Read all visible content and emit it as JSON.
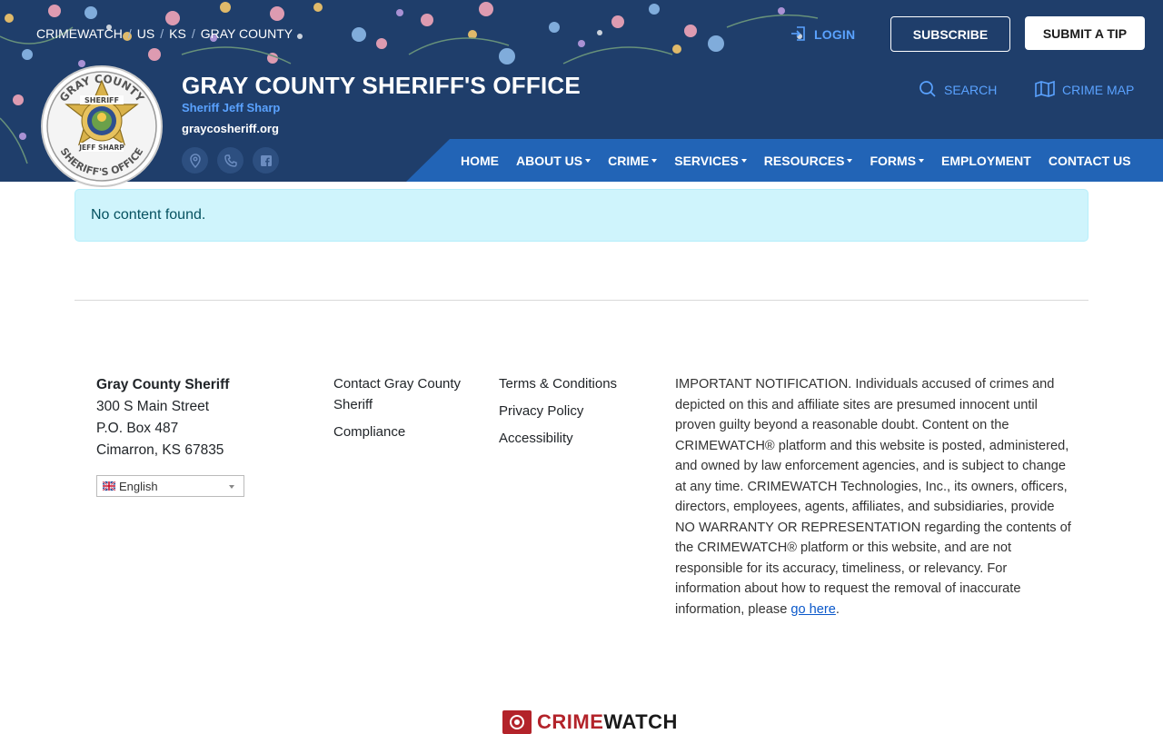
{
  "breadcrumb": [
    "CRIMEWATCH",
    "US",
    "KS",
    "GRAY COUNTY"
  ],
  "top_actions": {
    "login": "LOGIN",
    "subscribe": "SUBSCRIBE",
    "submit_tip": "SUBMIT A TIP"
  },
  "org": {
    "title": "GRAY COUNTY SHERIFF'S OFFICE",
    "subtitle": "Sheriff Jeff Sharp",
    "website": "graycosheriff.org",
    "badge_top": "GRAY COUNTY",
    "badge_star": "SHERIFF",
    "badge_name": "JEFF SHARP",
    "badge_bottom": "SHERIFF'S OFFICE"
  },
  "utility": {
    "search": "SEARCH",
    "crime_map": "CRIME MAP"
  },
  "nav": [
    {
      "label": "HOME",
      "dropdown": false
    },
    {
      "label": "ABOUT US",
      "dropdown": true
    },
    {
      "label": "CRIME",
      "dropdown": true
    },
    {
      "label": "SERVICES",
      "dropdown": true
    },
    {
      "label": "RESOURCES",
      "dropdown": true
    },
    {
      "label": "FORMS",
      "dropdown": true
    },
    {
      "label": "EMPLOYMENT",
      "dropdown": false
    },
    {
      "label": "CONTACT US",
      "dropdown": false
    }
  ],
  "alert": {
    "message": "No content found."
  },
  "footer": {
    "name": "Gray County Sheriff",
    "address1": "300 S Main Street",
    "address2": "P.O. Box 487",
    "address3": "Cimarron, KS 67835",
    "language": "English",
    "links_a": [
      "Contact Gray County Sheriff",
      "Compliance"
    ],
    "links_b": [
      "Terms & Conditions",
      "Privacy Policy",
      "Accessibility"
    ],
    "notice": "IMPORTANT NOTIFICATION. Individuals accused of crimes and depicted on this and affiliate sites are presumed innocent until proven guilty beyond a reasonable doubt. Content on the CRIMEWATCH® platform and this website is posted, administered, and owned by law enforcement agencies, and is subject to change at any time. CRIMEWATCH Technologies, Inc., its owners, officers, directors, employees, agents, affiliates, and subsidiaries, provide NO WARRANTY OR REPRESENTATION regarding the contents of the CRIMEWATCH® platform or this website, and are not responsible for its accuracy, timeliness, or relevancy. For information about how to request the removal of inaccurate information, please",
    "notice_link": "go here",
    "notice_end": ".",
    "brand_a": "CRIME",
    "brand_b": "WATCH"
  },
  "colors": {
    "header_bg": "#1f3e6b",
    "nav_bg": "#2264b6",
    "accent": "#5aa2ff",
    "alert_bg": "#cff4fc",
    "brand_red": "#b3232a"
  },
  "icons": [
    "login-icon",
    "search-icon",
    "map-icon",
    "location-icon",
    "phone-icon",
    "facebook-icon",
    "uk-flag-icon",
    "crimewatch-logo-icon"
  ]
}
